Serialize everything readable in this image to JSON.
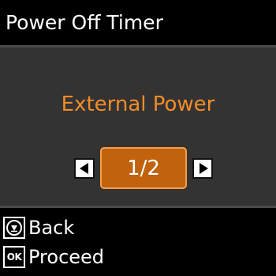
{
  "header": {
    "title": "Power Off Timer"
  },
  "selector": {
    "option_label": "External Power",
    "page_indicator": "1/2",
    "prev_icon": "left-arrow-icon",
    "next_icon": "right-arrow-icon"
  },
  "hints": {
    "back_label": "Back",
    "back_icon": "stop-button-icon",
    "proceed_label": "Proceed",
    "proceed_key": "OK"
  },
  "colors": {
    "accent": "#f28c28",
    "selection_fill": "#c0620e",
    "selection_border": "#f6a14a",
    "panel": "#333333",
    "background": "#000000"
  }
}
